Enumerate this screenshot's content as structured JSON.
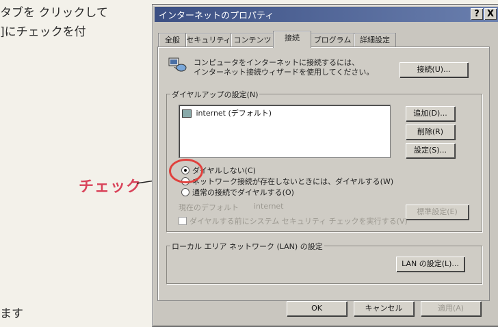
{
  "page_text": {
    "line1": "タブを クリックして",
    "line2": "]にチェックを付",
    "callout": "チェック",
    "bottom": "ます"
  },
  "dialog": {
    "title": "インターネットのプロパティ",
    "help_button": "?",
    "close_button": "X",
    "tabs": [
      "全般",
      "セキュリティ",
      "コンテンツ",
      "接続",
      "プログラム",
      "詳細設定"
    ],
    "active_tab": "接続",
    "wizard_text_1": "コンピュータをインターネットに接続するには、",
    "wizard_text_2": "インターネット接続ウィザードを使用してください。",
    "connect_button": "接続(U)...",
    "dialup_group_label": "ダイヤルアップの設定(N)",
    "dialup_entries": [
      "internet (デフォルト)"
    ],
    "add_button": "追加(D)...",
    "delete_button": "削除(R)",
    "settings_button": "設定(S)...",
    "radio_options": [
      "ダイヤルしない(C)",
      "ネットワーク接続が存在しないときには、ダイヤルする(W)",
      "通常の接続でダイヤルする(O)"
    ],
    "selected_radio": 0,
    "current_default_label": "現在のデフォルト",
    "current_default_value": "internet",
    "set_default_button": "標準設定(E)",
    "security_check_label": "ダイヤルする前にシステム セキュリティ チェックを実行する(V)",
    "lan_group_label": "ローカル エリア ネットワーク (LAN) の設定",
    "lan_button": "LAN の設定(L)...",
    "ok_button": "OK",
    "cancel_button": "キャンセル",
    "apply_button": "適用(A)"
  },
  "colors": {
    "callout": "#d9435a",
    "highlight": "#e0413d",
    "titlebar": "#3b4f83"
  }
}
